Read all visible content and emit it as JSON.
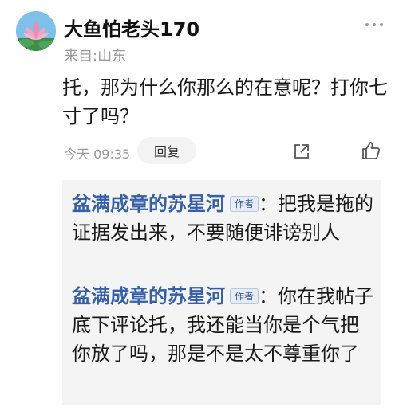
{
  "comment": {
    "username": "大鱼怕老头170",
    "location": "来自:山东",
    "text": "托，那为什么你那么的在意呢？打你七寸了吗？",
    "time": "今天 09:35",
    "reply_label": "回复"
  },
  "replies": [
    {
      "author": "盆满成章的苏星河",
      "badge": "作者",
      "separator": "：",
      "text": "把我是拖的证据发出来，不要随便诽谤别人"
    },
    {
      "author": "盆满成章的苏星河",
      "badge": "作者",
      "separator": "：",
      "text": "你在我帖子底下评论托，我还能当你是个气把你放了吗，那是不是太不尊重你了"
    }
  ]
}
